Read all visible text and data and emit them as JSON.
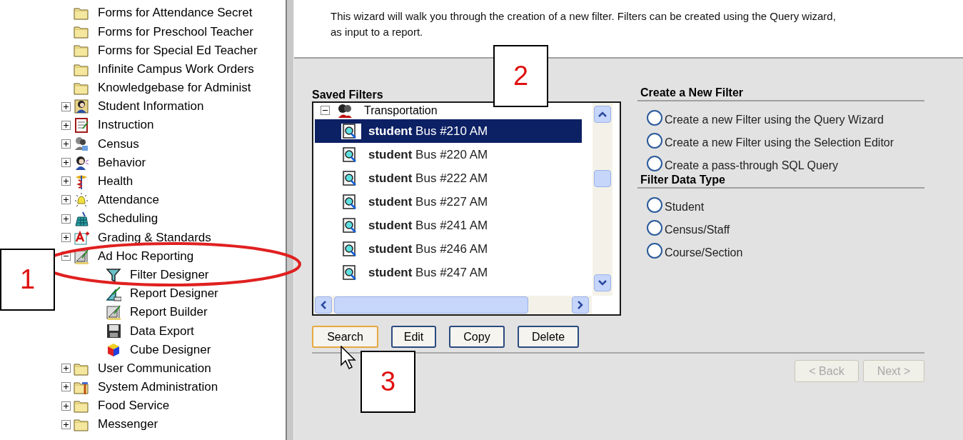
{
  "tree": {
    "items": [
      {
        "label": "Forms for Attendance Secret"
      },
      {
        "label": "Forms for Preschool Teacher"
      },
      {
        "label": "Forms for Special Ed Teacher"
      },
      {
        "label": "Infinite Campus Work Orders"
      },
      {
        "label": "Knowledgebase for Administ"
      },
      {
        "label": "Student Information",
        "expanded": false
      },
      {
        "label": "Instruction",
        "expanded": false
      },
      {
        "label": "Census",
        "expanded": false
      },
      {
        "label": "Behavior",
        "expanded": false
      },
      {
        "label": "Health",
        "expanded": false
      },
      {
        "label": "Attendance",
        "expanded": false
      },
      {
        "label": "Scheduling",
        "expanded": false
      },
      {
        "label": "Grading & Standards",
        "expanded": false
      },
      {
        "label": "Ad Hoc Reporting",
        "expanded": true,
        "children": [
          {
            "label": "Filter Designer"
          },
          {
            "label": "Report Designer"
          },
          {
            "label": "Report Builder"
          },
          {
            "label": "Data Export"
          },
          {
            "label": "Cube Designer"
          }
        ]
      },
      {
        "label": "User Communication",
        "expanded": false
      },
      {
        "label": "System Administration",
        "expanded": false
      },
      {
        "label": "Food Service",
        "expanded": false
      },
      {
        "label": "Messenger",
        "expanded": false
      }
    ]
  },
  "wizard": {
    "description_lines": [
      "This wizard will walk you through the creation of a new filter. Filters can be created using the Query wizard,",
      "as input to a report."
    ],
    "saved_filters": {
      "title": "Saved Filters",
      "group": {
        "label": "Transportation",
        "expanded": true,
        "children": [
          {
            "label": "**student** Bus #210 AM",
            "selected": true
          },
          {
            "label": "**student** Bus #220 AM",
            "selected": false
          },
          {
            "label": "**student** Bus #222 AM",
            "selected": false
          },
          {
            "label": "**student** Bus #227 AM",
            "selected": false
          },
          {
            "label": "**student** Bus #241 AM",
            "selected": false
          },
          {
            "label": "**student** Bus #246 AM",
            "selected": false
          },
          {
            "label": "**student** Bus #247 AM",
            "selected": false
          }
        ]
      }
    },
    "buttons": [
      {
        "label": "Search",
        "focused": true
      },
      {
        "label": "Edit",
        "focused": false
      },
      {
        "label": "Copy",
        "focused": false
      },
      {
        "label": "Delete",
        "focused": false
      }
    ],
    "create_section": {
      "title": "Create a New Filter",
      "options": [
        {
          "label": "Create a new Filter using the Query Wizard",
          "selected": false
        },
        {
          "label": "Create a new Filter using the Selection Editor",
          "selected": false
        },
        {
          "label": "Create a pass-through SQL Query",
          "selected": false
        }
      ]
    },
    "type_section": {
      "title": "Filter Data Type",
      "options": [
        {
          "label": "Student",
          "selected": false
        },
        {
          "label": "Census/Staff",
          "selected": false
        },
        {
          "label": "Course/Section",
          "selected": false
        }
      ]
    },
    "nav_buttons": [
      {
        "label": "< Back",
        "disabled": true
      },
      {
        "label": "Next >",
        "disabled": true
      }
    ]
  },
  "callouts": [
    {
      "label": "1"
    },
    {
      "label": "2"
    },
    {
      "label": "3"
    }
  ]
}
